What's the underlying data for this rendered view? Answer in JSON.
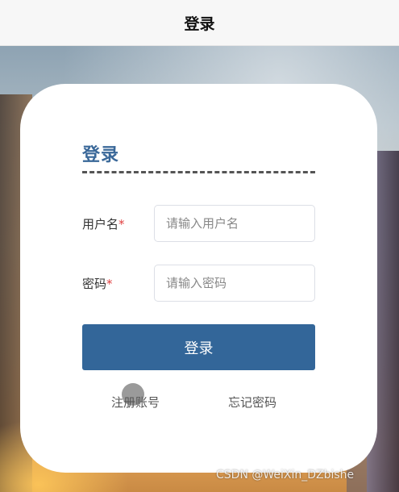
{
  "nav": {
    "title": "登录"
  },
  "card": {
    "title": "登录",
    "username": {
      "label": "用户名",
      "required_mark": "*",
      "placeholder": "请输入用户名",
      "value": ""
    },
    "password": {
      "label": "密码",
      "required_mark": "*",
      "placeholder": "请输入密码",
      "value": ""
    },
    "login_button": "登录",
    "register_link": "注册账号",
    "forgot_link": "忘记密码"
  },
  "watermark": "CSDN @WeiXin_DZbishe",
  "colors": {
    "accent": "#336699",
    "title": "#3a6899",
    "required": "#e04040"
  }
}
